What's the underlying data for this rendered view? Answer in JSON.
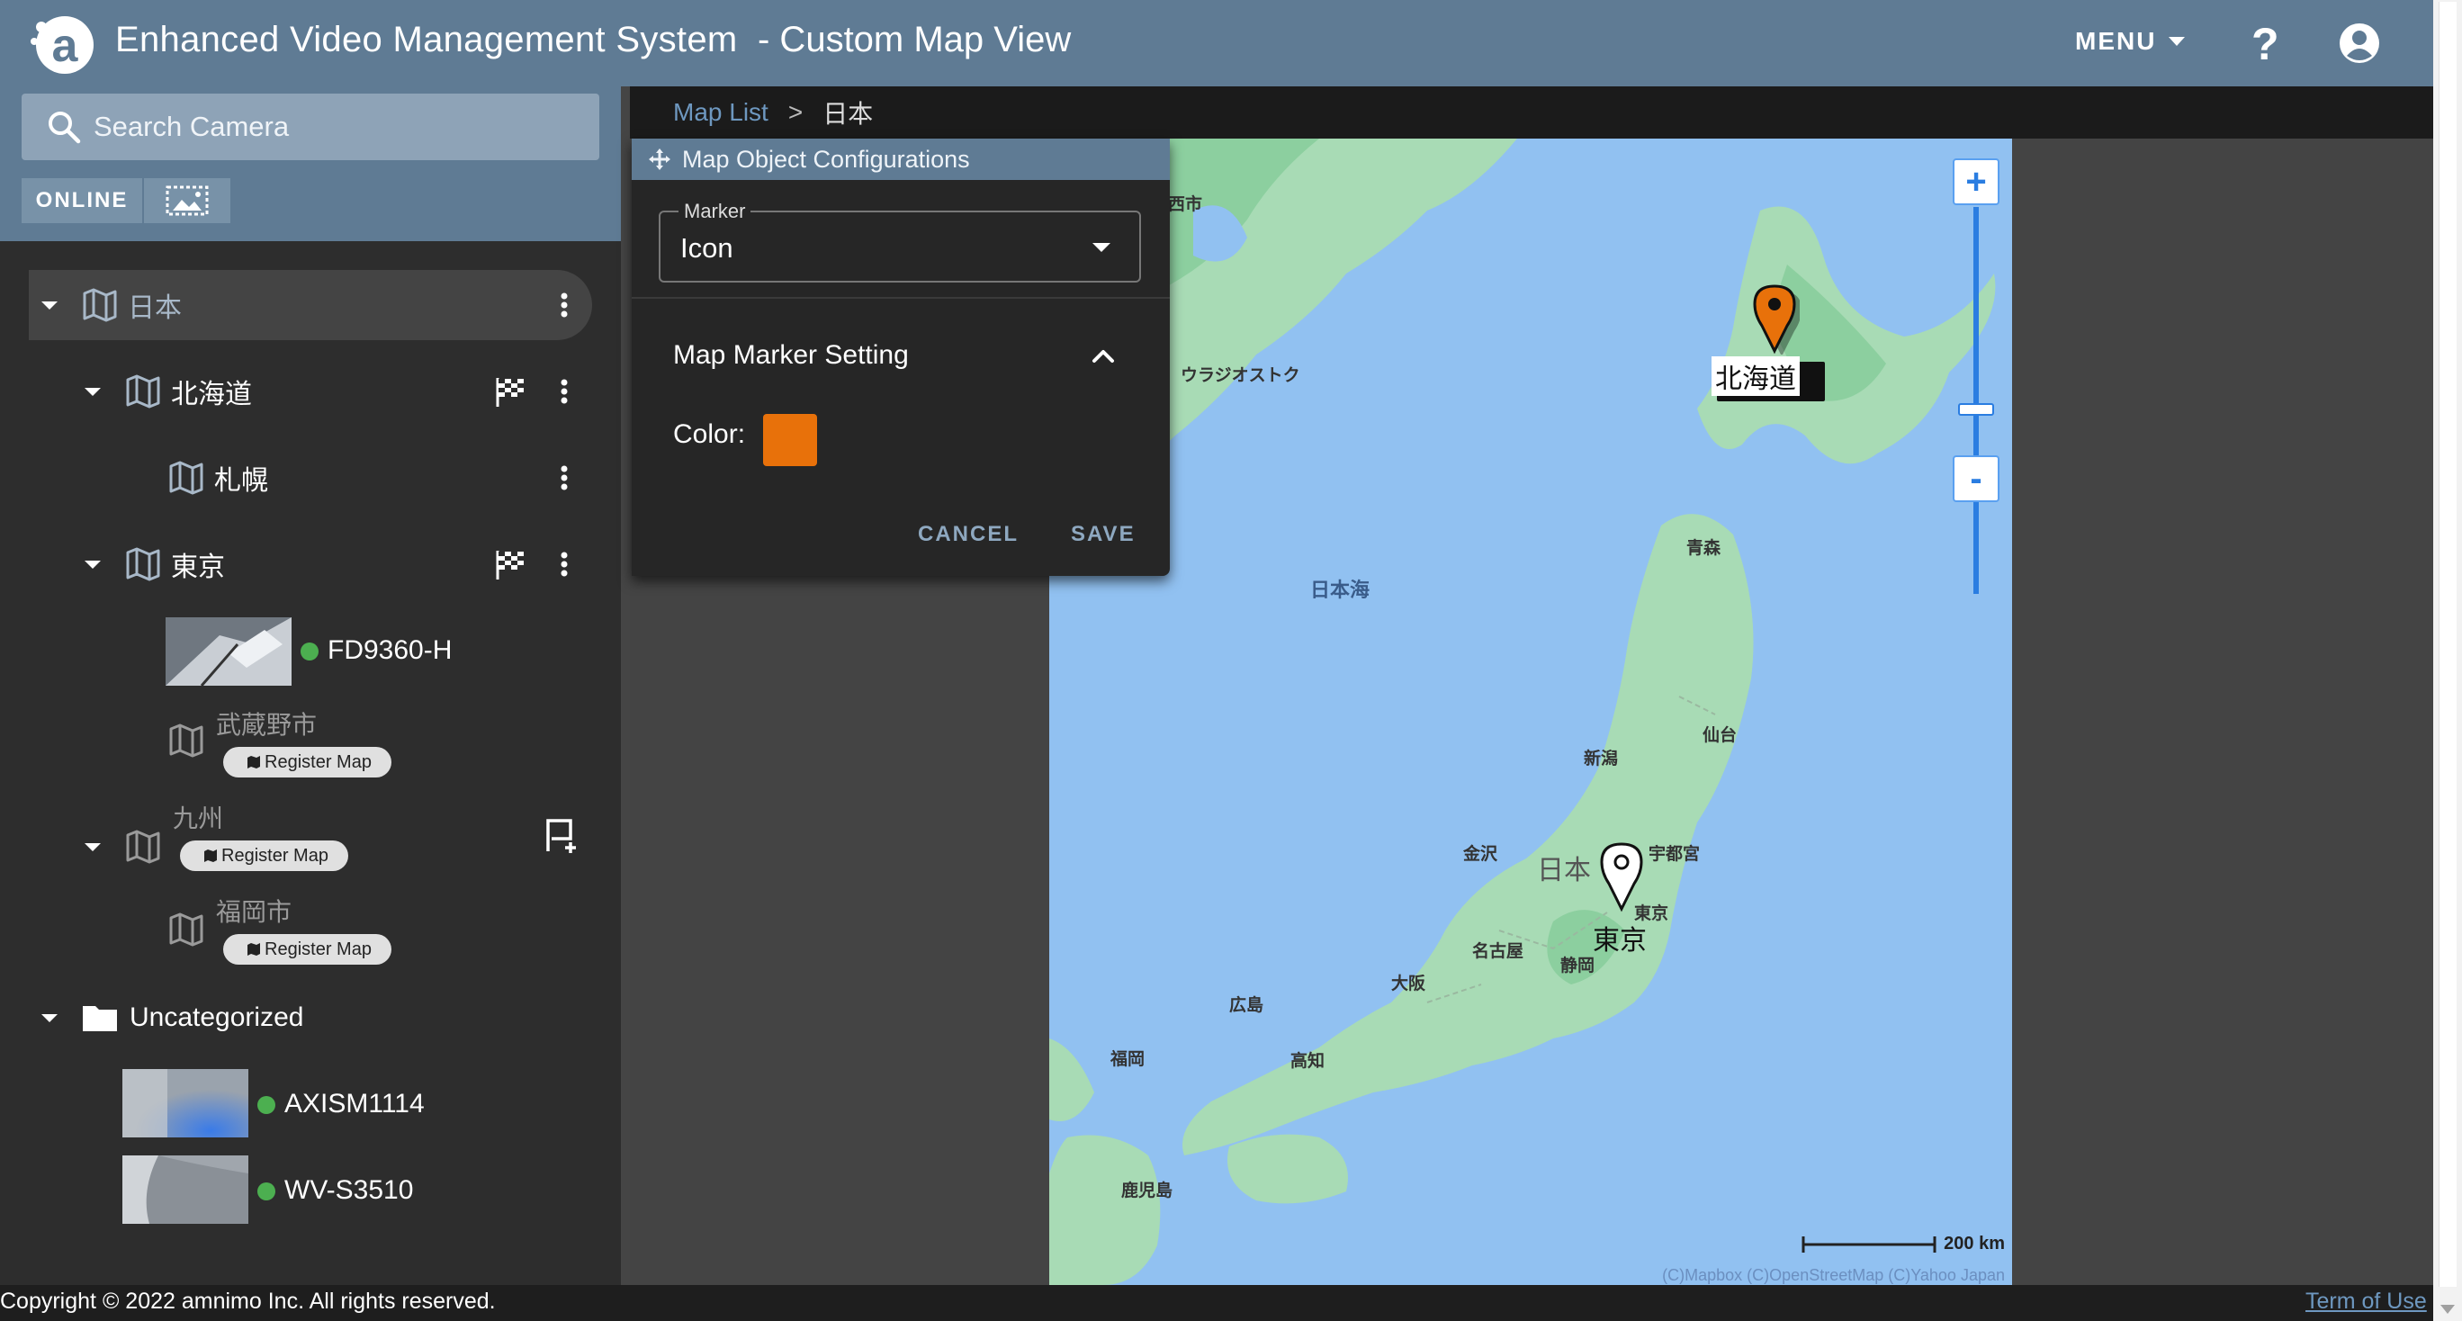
{
  "header": {
    "title": "Enhanced Video Management System",
    "subtitle": "- Custom Map View",
    "menu_label": "MENU",
    "help_label": "?"
  },
  "search": {
    "placeholder": "Search Camera"
  },
  "filters": {
    "online_label": "ONLINE"
  },
  "tree": {
    "root": {
      "label": "日本"
    },
    "hokkaido": {
      "label": "北海道"
    },
    "sapporo": {
      "label": "札幌"
    },
    "tokyo": {
      "label": "東京"
    },
    "camera_fd9360": {
      "name": "FD9360-H",
      "status": "online"
    },
    "musashino": {
      "label": "武蔵野市",
      "register_label": "Register Map"
    },
    "kyushu": {
      "label": "九州",
      "register_label": "Register Map"
    },
    "fukuoka": {
      "label": "福岡市",
      "register_label": "Register Map"
    },
    "uncategorized": {
      "label": "Uncategorized"
    },
    "camera_axis": {
      "name": "AXISM1114",
      "status": "online"
    },
    "camera_wv": {
      "name": "WV-S3510",
      "status": "online"
    }
  },
  "breadcrumb": {
    "link": "Map List",
    "separator": ">",
    "current": "日本"
  },
  "config_panel": {
    "title": "Map Object Configurations",
    "marker_legend": "Marker",
    "marker_value": "Icon",
    "section_title": "Map Marker Setting",
    "color_label": "Color:",
    "color_value": "#e8710a",
    "cancel_label": "CANCEL",
    "save_label": "SAVE"
  },
  "map": {
    "labels": {
      "vladivostok": "ウラジオストク",
      "sea_of_japan": "日本海",
      "aomori": "青森",
      "sendai": "仙台",
      "niigata": "新潟",
      "kanazawa": "金沢",
      "japan": "日本",
      "utsunomiya": "宇都宮",
      "tokyo": "東京",
      "nagoya": "名古屋",
      "shizuoka": "静岡",
      "osaka": "大阪",
      "hiroshima": "広島",
      "kochi": "高知",
      "fukuoka": "福岡",
      "kagoshima": "鹿児島",
      "top_left_fragment": "西市"
    },
    "markers": {
      "hokkaido": {
        "label": "北海道",
        "color": "#e8710a"
      },
      "tokyo": {
        "label": "東京",
        "color": "#ffffff"
      }
    },
    "scale_label": "200 km",
    "attribution": "(C)Mapbox (C)OpenStreetMap (C)Yahoo Japan",
    "zoom_in": "+",
    "zoom_out": "-"
  },
  "footer": {
    "copyright": "Copyright © 2022 amnimo Inc. All rights reserved.",
    "terms": "Term of Use"
  },
  "colors": {
    "header": "#5f7b94",
    "sidebar": "#2d2d2d",
    "online_status": "#4caf50",
    "link": "#6e98c0",
    "zoom_accent": "#2a7de1"
  }
}
